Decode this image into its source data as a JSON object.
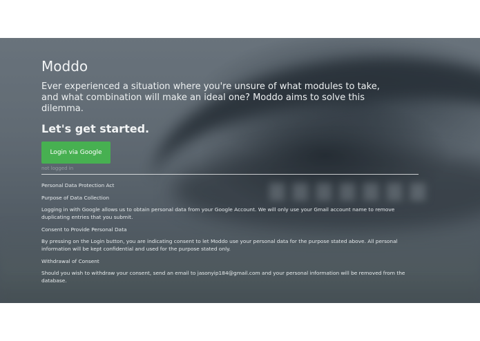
{
  "hero": {
    "title": "Moddo",
    "lead": "Ever experienced a situation where you're unsure of what modules to take, and what combination will make an ideal one? Moddo aims to solve this dilemma.",
    "cta_heading": "Let's get started.",
    "login_label": "Login via Google",
    "login_status": "not logged in",
    "login_button_color": "#47b051"
  },
  "policy": {
    "heading": "Personal Data Protection Act",
    "collection_heading": "Purpose of Data Collection",
    "collection_text": "Logging in with Google allows us to obtain personal data from your Google Account. We will only use your Gmail account name to remove duplicating entries that you submit.",
    "consent_heading": "Consent to Provide Personal Data",
    "consent_text": "By pressing on the Login button, you are indicating consent to let Moddo use your personal data for the purpose stated above. All personal information will be kept confidential and used for the purpose stated only.",
    "withdrawal_heading": "Withdrawal of Consent",
    "withdrawal_text": "Should you wish to withdraw your consent, send an email to jasonyip184@gmail.com and your personal information will be removed from the database."
  }
}
